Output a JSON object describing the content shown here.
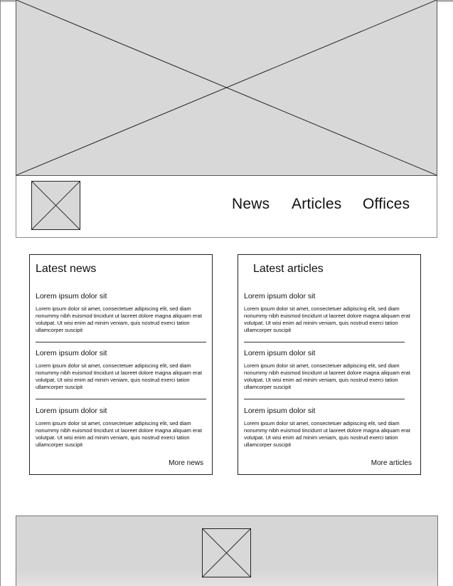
{
  "header": {
    "nav": {
      "news": "News",
      "articles": "Articles",
      "offices": "Offices"
    }
  },
  "latest_news": {
    "title": "Latest news",
    "items": [
      {
        "title": "Lorem ipsum dolor sit",
        "body": "Lorem ipsum dolor sit amet, consectetuer adipiscing elit, sed diam nonummy nibh euismod tincidunt ut laoreet dolore magna aliquam erat volutpat. Ut wisi enim ad minim veniam, quis nostrud exerci tation ullamcorper suscipit"
      },
      {
        "title": "Lorem ipsum dolor sit",
        "body": "Lorem ipsum dolor sit amet, consectetuer adipiscing elit, sed diam nonummy nibh euismod tincidunt ut laoreet dolore magna aliquam erat volutpat. Ut wisi enim ad minim veniam, quis nostrud exerci tation ullamcorper suscipit"
      },
      {
        "title": "Lorem ipsum dolor sit",
        "body": "Lorem ipsum dolor sit amet, consectetuer adipiscing elit, sed diam nonummy nibh euismod tincidunt ut laoreet dolore magna aliquam erat volutpat. Ut wisi enim ad minim veniam, quis nostrud exerci tation ullamcorper suscipit"
      }
    ],
    "more_label": "More news"
  },
  "latest_articles": {
    "title": "Latest articles",
    "items": [
      {
        "title": "Lorem ipsum dolor sit",
        "body": "Lorem ipsum dolor sit amet, consectetuer adipiscing elit, sed diam nonummy nibh euismod tincidunt ut laoreet dolore magna aliquam erat volutpat. Ut wisi enim ad minim veniam, quis nostrud exerci tation ullamcorper suscipit"
      },
      {
        "title": "Lorem ipsum dolor sit",
        "body": "Lorem ipsum dolor sit amet, consectetuer adipiscing elit, sed diam nonummy nibh euismod tincidunt ut laoreet dolore magna aliquam erat volutpat. Ut wisi enim ad minim veniam, quis nostrud exerci tation ullamcorper suscipit"
      },
      {
        "title": "Lorem ipsum dolor sit",
        "body": "Lorem ipsum dolor sit amet, consectetuer adipiscing elit, sed diam nonummy nibh euismod tincidunt ut laoreet dolore magna aliquam erat volutpat. Ut wisi enim ad minim veniam, quis nostrud exerci tation ullamcorper suscipit"
      }
    ],
    "more_label": "More articles"
  },
  "placeholders": {
    "hero_icon": "image-placeholder-icon",
    "logo_icon": "image-placeholder-icon",
    "footer_icon": "image-placeholder-icon"
  },
  "colors": {
    "placeholder_fill": "#d8d8d8",
    "stroke": "#222222"
  }
}
